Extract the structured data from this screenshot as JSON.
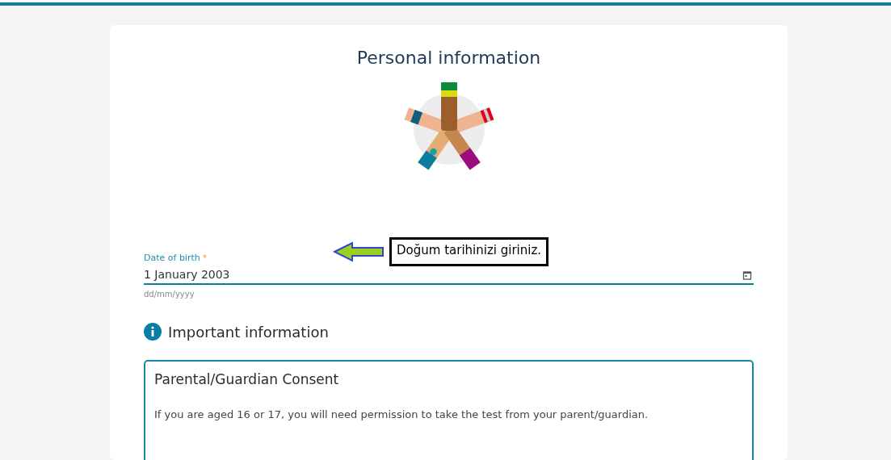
{
  "page": {
    "title": "Personal information"
  },
  "date_field": {
    "label": "Date of birth",
    "required_mark": "*",
    "value": "1 January 2003",
    "hint": "dd/mm/yyyy",
    "focused": true
  },
  "annotation": {
    "text": "Doğum tarihinizi giriniz."
  },
  "important": {
    "heading": "Important information",
    "notice": {
      "title": "Parental/Guardian Consent",
      "body": "If you are aged 16 or 17, you will need permission to take the test from your parent/guardian."
    }
  }
}
